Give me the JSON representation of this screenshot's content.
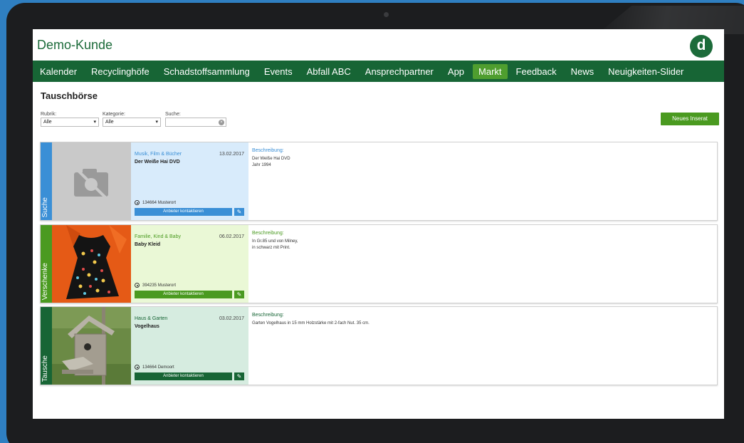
{
  "app": {
    "title": "Demo-Kunde",
    "logo_letter": "d"
  },
  "nav": {
    "items": [
      "Kalender",
      "Recyclinghöfe",
      "Schadstoffsammlung",
      "Events",
      "Abfall ABC",
      "Ansprechpartner",
      "App",
      "Markt",
      "Feedback",
      "News",
      "Neuigkeiten-Slider"
    ],
    "active": "Markt"
  },
  "page": {
    "title": "Tauschbörse"
  },
  "filters": {
    "rubrik_label": "Rubrik:",
    "rubrik_value": "Alle",
    "kategorie_label": "Kategorie:",
    "kategorie_value": "Alle",
    "suche_label": "Suche:",
    "suche_value": ""
  },
  "new_button_label": "Neues Inserat",
  "listings": [
    {
      "type": "Suche",
      "category": "Musik, Film & Bücher",
      "date": "13.02.2017",
      "title": "Der Weiße Hai DVD",
      "location": "134664 Musterort",
      "contact_label": "Anbieter kontaktieren",
      "description_label": "Beschreibung:",
      "description_lines": [
        "Der Weiße Hai DVD",
        "Jahr 1994"
      ],
      "colors": {
        "accent": "#3a8fd6",
        "panel": "#d8ebfb",
        "text": "#3a8fd6"
      }
    },
    {
      "type": "Verschenke",
      "category": "Familie, Kind & Baby",
      "date": "06.02.2017",
      "title": "Baby Kleid",
      "location": "394235 Musterort",
      "contact_label": "Anbieter kontaktieren",
      "description_label": "Beschreibung:",
      "description_lines": [
        "In Gr.85 und von Milney,",
        "in schwarz mit Print."
      ],
      "colors": {
        "accent": "#4a9a20",
        "panel": "#eaf8d6",
        "text": "#4a9a20"
      }
    },
    {
      "type": "Tausche",
      "category": "Haus & Garten",
      "date": "03.02.2017",
      "title": "Vogelhaus",
      "location": "134664 Demoort",
      "contact_label": "Anbieter kontaktieren",
      "description_label": "Beschreibung:",
      "description_lines": [
        "Garten Vogelhaus in 15 mm Holzstärke mit 2-fach Nut. 35 cm."
      ],
      "colors": {
        "accent": "#176535",
        "panel": "#d6ece0",
        "text": "#176535"
      }
    }
  ]
}
